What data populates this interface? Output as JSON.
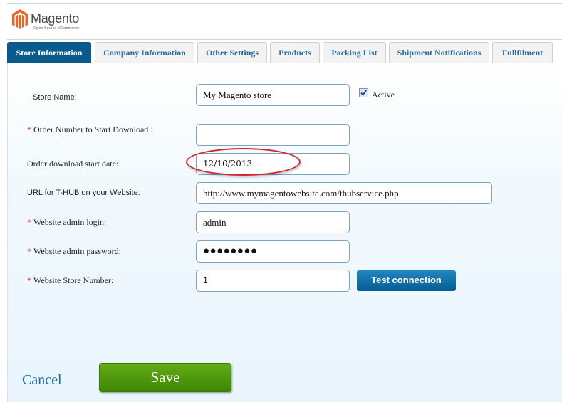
{
  "brand": {
    "name": "Magento",
    "tagline": "Open Source eCommerce",
    "logo_icon": "magento-logo-icon",
    "color": "#f26322"
  },
  "tabs": [
    {
      "label": "Store Information",
      "active": true
    },
    {
      "label": "Company Information",
      "active": false
    },
    {
      "label": "Other Settings",
      "active": false
    },
    {
      "label": "Products",
      "active": false
    },
    {
      "label": "Packing List",
      "active": false
    },
    {
      "label": "Shipment Notifications",
      "active": false
    },
    {
      "label": "Fullfilment",
      "active": false
    }
  ],
  "form": {
    "store_name": {
      "label": "Store Name:",
      "value": "My Magento store",
      "required": false
    },
    "active": {
      "label": "Active",
      "checked": true
    },
    "order_number": {
      "label": "Order Number to Start Download :",
      "value": "",
      "required": true
    },
    "order_date": {
      "label": "Order download start date:",
      "value": "12/10/2013",
      "required": false,
      "highlighted": true
    },
    "url": {
      "label": "URL for T-HUB on your Website:",
      "value": "http://www.mymagentowebsite.com/thubservice.php",
      "required": false
    },
    "admin_login": {
      "label": "Website admin login:",
      "value": "admin",
      "required": true
    },
    "admin_password": {
      "label": "Website admin password:",
      "value": "●●●●●●●●",
      "required": true
    },
    "store_number": {
      "label": "Website Store Number:",
      "value": "1",
      "required": true
    }
  },
  "required_marker": "*",
  "buttons": {
    "test_connection": "Test connection",
    "cancel": "Cancel",
    "save": "Save"
  },
  "colors": {
    "active_tab": "#0a5a8e",
    "tab_text": "#2d6aa0",
    "save_green": "#4f9a0c",
    "highlight_circle": "#d3242c",
    "required": "#d0222a"
  }
}
